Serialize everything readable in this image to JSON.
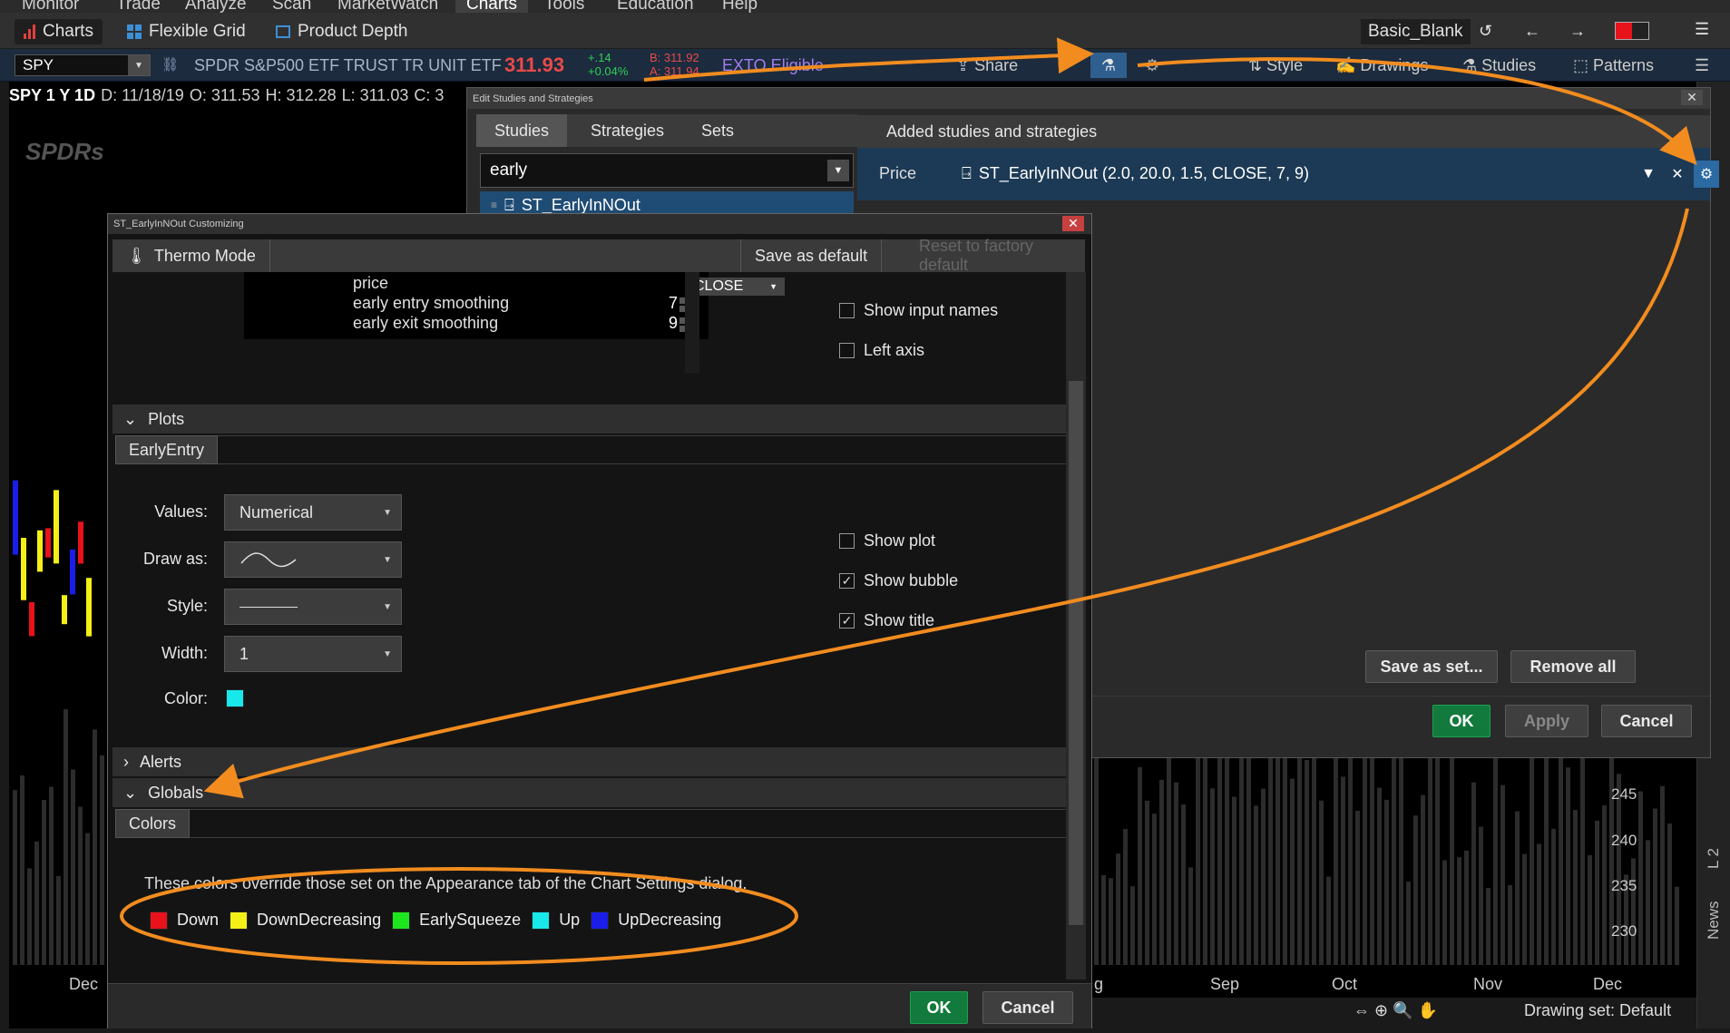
{
  "menu": [
    "Monitor",
    "Trade",
    "Analyze",
    "Scan",
    "MarketWatch",
    "Charts",
    "Tools",
    "Education",
    "Help"
  ],
  "menu_active": "Charts",
  "tabs": {
    "charts": "Charts",
    "flexible_grid": "Flexible Grid",
    "product_depth": "Product Depth",
    "layout": "Basic_Blank"
  },
  "symbol_bar": {
    "symbol": "SPY",
    "name": "SPDR S&P500 ETF TRUST TR UNIT ETF",
    "price": "311.93",
    "change": "+.14",
    "change_pct": "+0.04%",
    "bid": "B: 311.92",
    "ask": "A: 311.94",
    "exto": "EXTO Eligible",
    "share": "Share",
    "style": "Style",
    "drawings": "Drawings",
    "studies": "Studies",
    "patterns": "Patterns"
  },
  "chart_info": {
    "symbol": "SPY 1 Y 1D",
    "date": "D: 11/18/19",
    "open": "O: 311.53",
    "high": "H: 312.28",
    "low": "L: 311.03",
    "close": "C: 3"
  },
  "chart": {
    "logo": "SPDRs",
    "y_ticks": [
      "245",
      "240",
      "235",
      "230"
    ],
    "x_ticks": [
      "Dec",
      "Sep",
      "Oct",
      "Nov",
      "Dec"
    ],
    "x_tick_partial": "g",
    "drawing_set": "Drawing set: Default",
    "right_tabs": [
      "L 2",
      "News"
    ]
  },
  "edit_studies": {
    "title": "Edit Studies and Strategies",
    "tabs": [
      "Studies",
      "Strategies",
      "Sets"
    ],
    "search": "early",
    "result": "ST_EarlyInNOut",
    "added_header": "Added studies and strategies",
    "row_label": "Price",
    "row_value": "ST_EarlyInNOut (2.0, 20.0, 1.5, CLOSE, 7, 9)",
    "save_as_set": "Save as set...",
    "remove_all": "Remove all",
    "ok": "OK",
    "apply": "Apply",
    "cancel": "Cancel"
  },
  "customizing": {
    "title": "ST_EarlyInNOut Customizing",
    "thermo": "Thermo Mode",
    "save_default": "Save as default",
    "reset_default": "Reset to factory default",
    "inputs": [
      {
        "name": "price",
        "value": "CLOSE"
      },
      {
        "name": "early entry smoothing",
        "value": "7"
      },
      {
        "name": "early exit smoothing",
        "value": "9"
      }
    ],
    "options": [
      "Show input names",
      "Left axis"
    ],
    "plots_title": "Plots",
    "plot_tab": "EarlyEntry",
    "values_label": "Values:",
    "values_val": "Numerical",
    "draw_as_label": "Draw as:",
    "style_label": "Style:",
    "width_label": "Width:",
    "width_val": "1",
    "color_label": "Color:",
    "color_val": "#18e8ea",
    "show_plot": "Show plot",
    "show_bubble": "Show bubble",
    "show_title": "Show title",
    "alerts": "Alerts",
    "globals": "Globals",
    "colors_tab": "Colors",
    "globals_note": "These colors override those set on the Appearance tab of the Chart Settings dialog.",
    "global_colors": [
      {
        "name": "Down",
        "color": "#e8121b"
      },
      {
        "name": "DownDecreasing",
        "color": "#f4f017"
      },
      {
        "name": "EarlySqueeze",
        "color": "#1ee61e"
      },
      {
        "name": "Up",
        "color": "#18e8ea"
      },
      {
        "name": "UpDecreasing",
        "color": "#1a1ee8"
      }
    ],
    "ok": "OK",
    "cancel": "Cancel"
  },
  "colors": {
    "accent": "#f28c1f",
    "select": "#1f4c74",
    "price": "#e84a4a"
  }
}
